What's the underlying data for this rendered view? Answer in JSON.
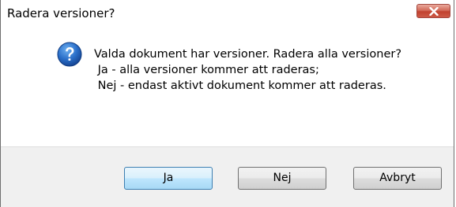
{
  "window": {
    "title": "Radera versioner?"
  },
  "titlebar": {
    "close_icon": "close-icon"
  },
  "dialog": {
    "icon": "question-icon",
    "message_lines": [
      "Valda dokument har versioner. Radera alla versioner?",
      " Ja - alla versioner kommer att raderas;",
      " Nej - endast aktivt dokument kommer att raderas."
    ]
  },
  "buttons": {
    "yes_label": "Ja",
    "no_label": "Nej",
    "cancel_label": "Avbryt"
  },
  "colors": {
    "close_button": "#c7503d",
    "default_button_border": "#3c7fb1",
    "footer_background": "#f0f0f0",
    "question_icon": "#1f5fb4"
  }
}
